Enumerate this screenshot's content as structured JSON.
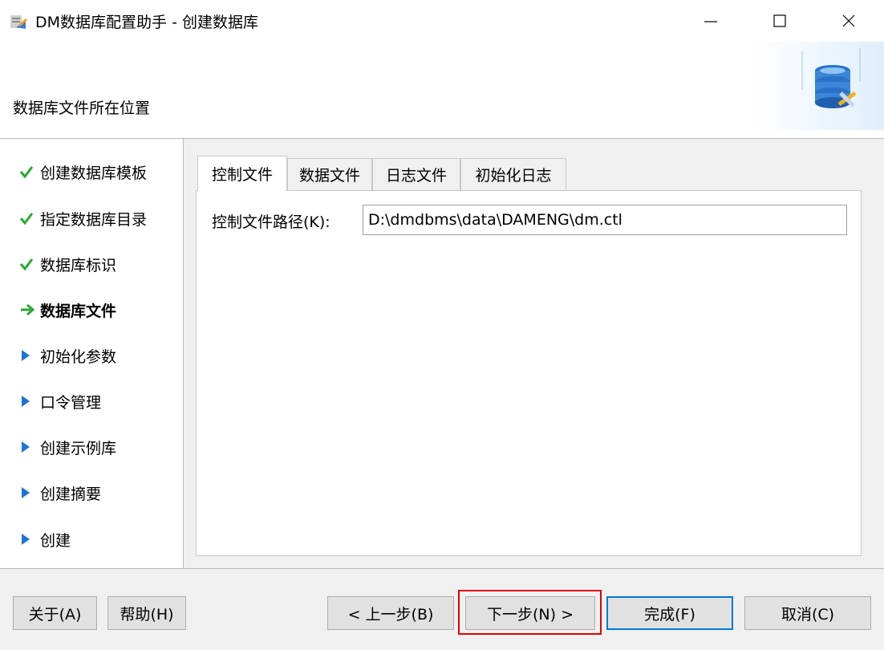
{
  "window": {
    "title": "DM数据库配置助手 - 创建数据库",
    "minimize_glyph": "—",
    "maximize_glyph": "☐",
    "close_glyph": "✕"
  },
  "header": {
    "title": "数据库文件所在位置",
    "graphic_icon": "database-gear-icon"
  },
  "sidebar": {
    "steps": [
      {
        "label": "创建数据库模板",
        "state": "done"
      },
      {
        "label": "指定数据库目录",
        "state": "done"
      },
      {
        "label": "数据库标识",
        "state": "done"
      },
      {
        "label": "数据库文件",
        "state": "current"
      },
      {
        "label": "初始化参数",
        "state": "pending"
      },
      {
        "label": "口令管理",
        "state": "pending"
      },
      {
        "label": "创建示例库",
        "state": "pending"
      },
      {
        "label": "创建摘要",
        "state": "pending"
      },
      {
        "label": "创建",
        "state": "pending"
      }
    ]
  },
  "tabs": [
    {
      "label": "控制文件",
      "active": true
    },
    {
      "label": "数据文件",
      "active": false
    },
    {
      "label": "日志文件",
      "active": false
    },
    {
      "label": "初始化日志",
      "active": false
    }
  ],
  "control_file": {
    "path_label": "控制文件路径(K):",
    "path_value": "D:\\dmdbms\\data\\DAMENG\\dm.ctl"
  },
  "buttons": {
    "about": "关于(A)",
    "help": "帮助(H)",
    "back": "< 上一步(B)",
    "next": "下一步(N) >",
    "finish": "完成(F)",
    "cancel": "取消(C)"
  },
  "colors": {
    "check_green": "#2aa830",
    "arrow_green": "#2aa830",
    "pending_blue": "#1e73d2",
    "default_button_border": "#0078d7",
    "highlight_red": "#e00000"
  }
}
